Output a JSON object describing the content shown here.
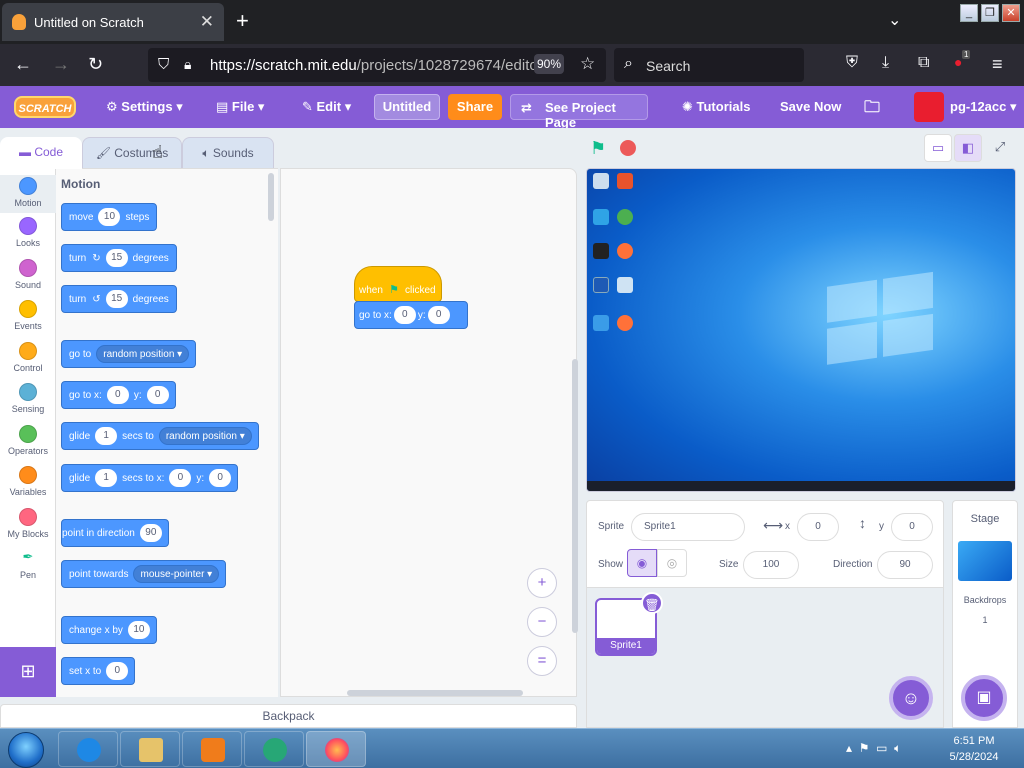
{
  "browser": {
    "tab_title": "Untitled on Scratch",
    "tab_close": "✕",
    "new_tab": "+",
    "tab_list": "⌄",
    "url_host": "https://scratch.mit.edu",
    "url_path": "/projects/1028729674/editor",
    "zoom": "90%",
    "search_placeholder": "Search",
    "ext_badge": "1"
  },
  "menubar": {
    "logo": "SCRATCH",
    "settings": "Settings",
    "file": "File",
    "edit": "Edit",
    "title_field": "Untitled",
    "share": "Share",
    "see_project": "See Project Page",
    "tutorials": "Tutorials",
    "save_now": "Save Now",
    "username": "pg-12acc"
  },
  "tabs": {
    "code": "Code",
    "costumes": "Costumes",
    "sounds": "Sounds"
  },
  "categories": [
    {
      "label": "Motion",
      "color": "#4c97ff"
    },
    {
      "label": "Looks",
      "color": "#9966ff"
    },
    {
      "label": "Sound",
      "color": "#cf63cf"
    },
    {
      "label": "Events",
      "color": "#ffbf00"
    },
    {
      "label": "Control",
      "color": "#ffab19"
    },
    {
      "label": "Sensing",
      "color": "#5cb1d6"
    },
    {
      "label": "Operators",
      "color": "#59c059"
    },
    {
      "label": "Variables",
      "color": "#ff8c1a"
    },
    {
      "label": "My Blocks",
      "color": "#ff6680"
    },
    {
      "label": "Pen",
      "color": "#0fbd8c"
    }
  ],
  "palette": {
    "heading": "Motion",
    "move": {
      "a": "move",
      "v": "10",
      "b": "steps"
    },
    "turn_right": {
      "a": "turn",
      "v": "15",
      "b": "degrees"
    },
    "turn_left": {
      "a": "turn",
      "v": "15",
      "b": "degrees"
    },
    "goto": {
      "a": "go to",
      "d": "random position"
    },
    "goto_xy": {
      "a": "go to x:",
      "x": "0",
      "b": "y:",
      "y": "0"
    },
    "glide_to": {
      "a": "glide",
      "v": "1",
      "b": "secs to",
      "d": "random position"
    },
    "glide_xy": {
      "a": "glide",
      "v": "1",
      "b": "secs to x:",
      "x": "0",
      "c": "y:",
      "y": "0"
    },
    "point_dir": {
      "a": "point in direction",
      "v": "90"
    },
    "point_towards": {
      "a": "point towards",
      "d": "mouse-pointer"
    },
    "change_x": {
      "a": "change x by",
      "v": "10"
    },
    "set_x": {
      "a": "set x to",
      "v": "0"
    }
  },
  "script": {
    "hat_a": "when",
    "hat_b": "clicked",
    "goto_a": "go to x:",
    "x": "0",
    "goto_b": "y:",
    "y": "0"
  },
  "canvas": {
    "zoom_in": "+",
    "zoom_out": "−",
    "reset": "="
  },
  "backpack": "Backpack",
  "sprite_info": {
    "sprite_label": "Sprite",
    "sprite_name": "Sprite1",
    "x_label": "x",
    "x_value": "0",
    "y_label": "y",
    "y_value": "0",
    "show_label": "Show",
    "size_label": "Size",
    "size_value": "100",
    "direction_label": "Direction",
    "direction_value": "90"
  },
  "sprite_list": {
    "item_name": "Sprite1"
  },
  "stage_pane": {
    "title": "Stage",
    "backdrops_label": "Backdrops",
    "backdrops_count": "1"
  },
  "clock": {
    "time": "6:51 PM",
    "date": "5/28/2024"
  },
  "colors": {
    "scratch_purple": "#855cd6",
    "motion_blue": "#4c97ff",
    "events_yellow": "#ffbf00",
    "share_orange": "#ff8c1a",
    "stop_red": "#ec5959",
    "flag_green": "#0fbd8c"
  },
  "icons": [
    "tab-favicon-icon",
    "back-icon",
    "forward-icon",
    "reload-icon",
    "shield-icon",
    "lock-icon",
    "star-icon",
    "search-icon",
    "pocket-icon",
    "download-icon",
    "extensions-icon",
    "menu-icon",
    "gear-icon",
    "file-icon",
    "pencil-icon",
    "remix-icon",
    "bulb-icon",
    "folder-icon",
    "green-flag-icon",
    "stop-icon",
    "trash-icon",
    "add-sprite-icon",
    "add-backdrop-icon"
  ]
}
